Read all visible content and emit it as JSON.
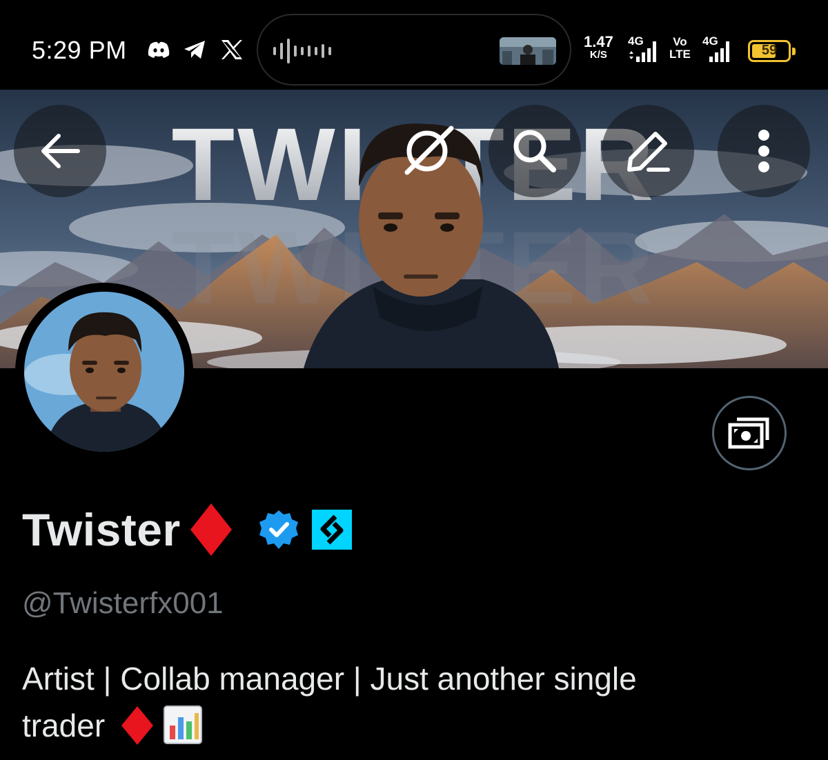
{
  "status_bar": {
    "time": "5:29 PM",
    "notification_icons": [
      "discord-icon",
      "telegram-icon",
      "x-icon"
    ],
    "network_speed_value": "1.47",
    "network_speed_unit": "K/S",
    "signal_1_label": "4G",
    "volte_label_1": "Vo",
    "volte_label_2": "LTE",
    "signal_2_label": "4G",
    "battery_level": "59",
    "battery_color": "#f2c230"
  },
  "banner": {
    "title_text": "TWISTER",
    "sky_color": "#253448"
  },
  "header_actions": {
    "back_icon": "arrow-left-icon",
    "grok_icon": "grok-icon",
    "search_icon": "search-icon",
    "edit_icon": "pencil-icon",
    "more_icon": "more-vertical-icon"
  },
  "profile": {
    "display_name": "Twister",
    "name_emoji": "♦️",
    "verified_badge_color": "#1d9bf0",
    "affiliate_badge_color": "#00d4ff",
    "handle": "@Twisterfx001",
    "bio_line_1": "Artist | Collab manager | Just another single",
    "bio_line_2_text": "trader",
    "bio_line_2_emoji_1": "♦️",
    "bio_line_2_emoji_2": "📊",
    "tip_icon": "money-icon"
  }
}
